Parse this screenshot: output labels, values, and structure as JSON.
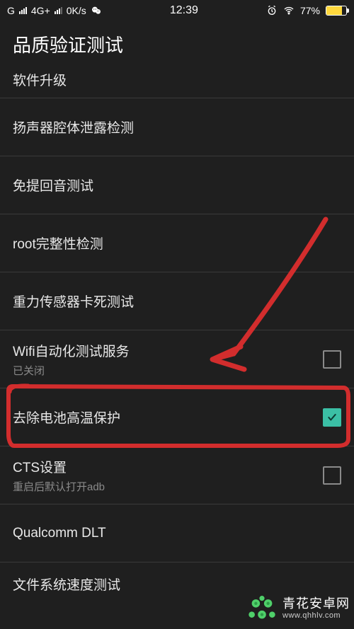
{
  "status": {
    "carrier": "G",
    "net_type": "4G+",
    "speed": "0K/s",
    "time": "12:39",
    "battery_percent": "77%"
  },
  "header": {
    "title": "品质验证测试"
  },
  "rows": {
    "r0": {
      "title": "软件升级"
    },
    "r1": {
      "title": "扬声器腔体泄露检测"
    },
    "r2": {
      "title": "免提回音测试"
    },
    "r3": {
      "title": "root完整性检测"
    },
    "r4": {
      "title": "重力传感器卡死测试"
    },
    "r5": {
      "title": "Wifi自动化测试服务",
      "sub": "已关闭",
      "checked": false
    },
    "r6": {
      "title": "去除电池高温保护",
      "checked": true
    },
    "r7": {
      "title": "CTS设置",
      "sub": "重启后默认打开adb",
      "checked": false
    },
    "r8": {
      "title": "Qualcomm DLT"
    },
    "r9": {
      "title": "文件系统速度测试"
    }
  },
  "watermark": {
    "name": "青花安卓网",
    "url": "www.qhhlv.com"
  }
}
